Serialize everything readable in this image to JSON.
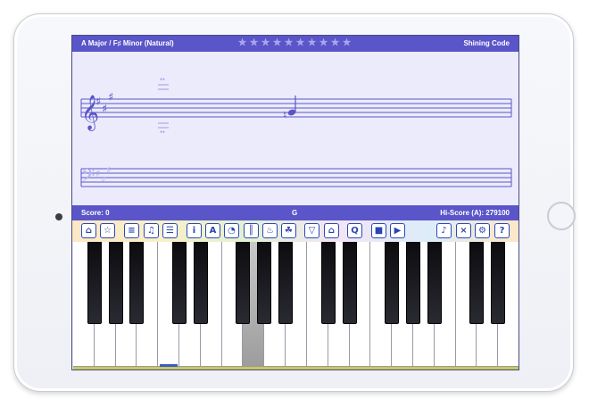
{
  "header": {
    "scale_label": "A Major  /  F♯ Minor (Natural)",
    "brand": "Shining Code",
    "stars_total": 10,
    "stars_filled": 0,
    "star_glyph": "★"
  },
  "staff": {
    "treble_clef": "𝄞",
    "bass_clef": "𝄢",
    "sharp": "♯",
    "natural": "♮"
  },
  "status": {
    "score_label": "Score: 0",
    "current_note": "G",
    "hiscore_label": "Hi-Score (A): 279100"
  },
  "toolbar": {
    "buttons": [
      {
        "name": "home-icon",
        "glyph": "⌂"
      },
      {
        "name": "star-icon",
        "glyph": "☆"
      },
      {
        "name": "staff-icon",
        "glyph": "≡"
      },
      {
        "name": "note-grid-icon",
        "glyph": "♫"
      },
      {
        "name": "menu-icon",
        "glyph": "☰"
      },
      {
        "name": "info-icon",
        "glyph": "i"
      },
      {
        "name": "letter-a-icon",
        "glyph": "A"
      },
      {
        "name": "palette-icon",
        "glyph": "◔"
      },
      {
        "name": "piano-icon",
        "glyph": "║"
      },
      {
        "name": "flame-icon",
        "glyph": "♨"
      },
      {
        "name": "turtle-icon",
        "glyph": "☘"
      },
      {
        "name": "shield-icon",
        "glyph": "▽"
      },
      {
        "name": "shape-icon",
        "glyph": "⌂"
      },
      {
        "name": "quiz-icon",
        "glyph": "Q"
      },
      {
        "name": "stop-icon",
        "glyph": "■"
      },
      {
        "name": "play-icon",
        "glyph": "▶"
      },
      {
        "name": "speaker-icon",
        "glyph": "♪"
      },
      {
        "name": "mute-icon",
        "glyph": "×"
      },
      {
        "name": "gear-icon",
        "glyph": "⚙"
      },
      {
        "name": "help-icon",
        "glyph": "?"
      }
    ]
  },
  "keyboard": {
    "white_keys": 21,
    "pressed_white_key_index": 8
  },
  "colors": {
    "accent": "#5a55c8",
    "staff_line": "#5a55c8",
    "screen_bg": "#ecebfb"
  }
}
